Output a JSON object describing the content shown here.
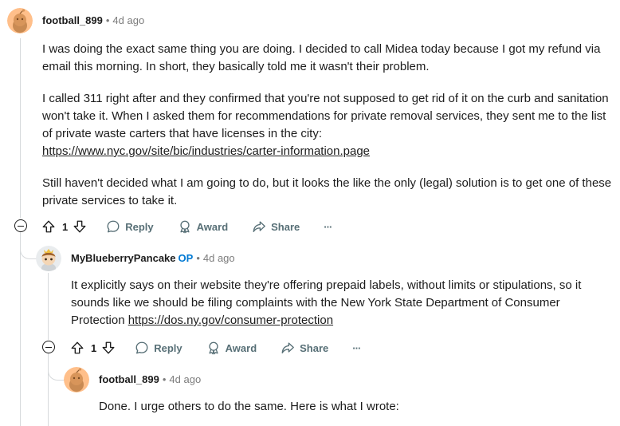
{
  "colors": {
    "link": "#1c1c1c",
    "op": "#0079d3",
    "muted": "#7c7c7c",
    "action": "#576f76",
    "thread": "#d7dadc"
  },
  "comments": [
    {
      "author": "football_899",
      "separator": "•",
      "time": "4d ago",
      "paragraphs": [
        "I was doing the exact same thing you are doing. I decided to call Midea today because I got my refund via email this morning. In short, they basically told me it wasn't their problem.",
        "I called 311 right after and they confirmed that you're not supposed to get rid of it on the curb and sanitation won't take it. When I asked them for recommendations for private removal services, they sent me to the list of private waste carters that have licenses in the city:",
        "Still haven't decided what I am going to do, but it looks the like the only (legal) solution is to get one of these private services to take it."
      ],
      "link": "https://www.nyc.gov/site/bic/industries/carter-information.page",
      "score": "1",
      "actions": {
        "reply": "Reply",
        "award": "Award",
        "share": "Share",
        "more": "···"
      }
    },
    {
      "author": "MyBlueberryPancake",
      "op_badge": "OP",
      "separator": "•",
      "time": "4d ago",
      "text": "It explicitly says on their website they're offering prepaid labels, without limits or stipulations, so it sounds like we should be filing complaints with the New York State Department of Consumer Protection",
      "link": "https://dos.ny.gov/consumer-protection",
      "score": "1",
      "actions": {
        "reply": "Reply",
        "award": "Award",
        "share": "Share",
        "more": "···"
      }
    },
    {
      "author": "football_899",
      "separator": "•",
      "time": "4d ago",
      "text": "Done. I urge others to do the same. Here is what I wrote:"
    }
  ]
}
